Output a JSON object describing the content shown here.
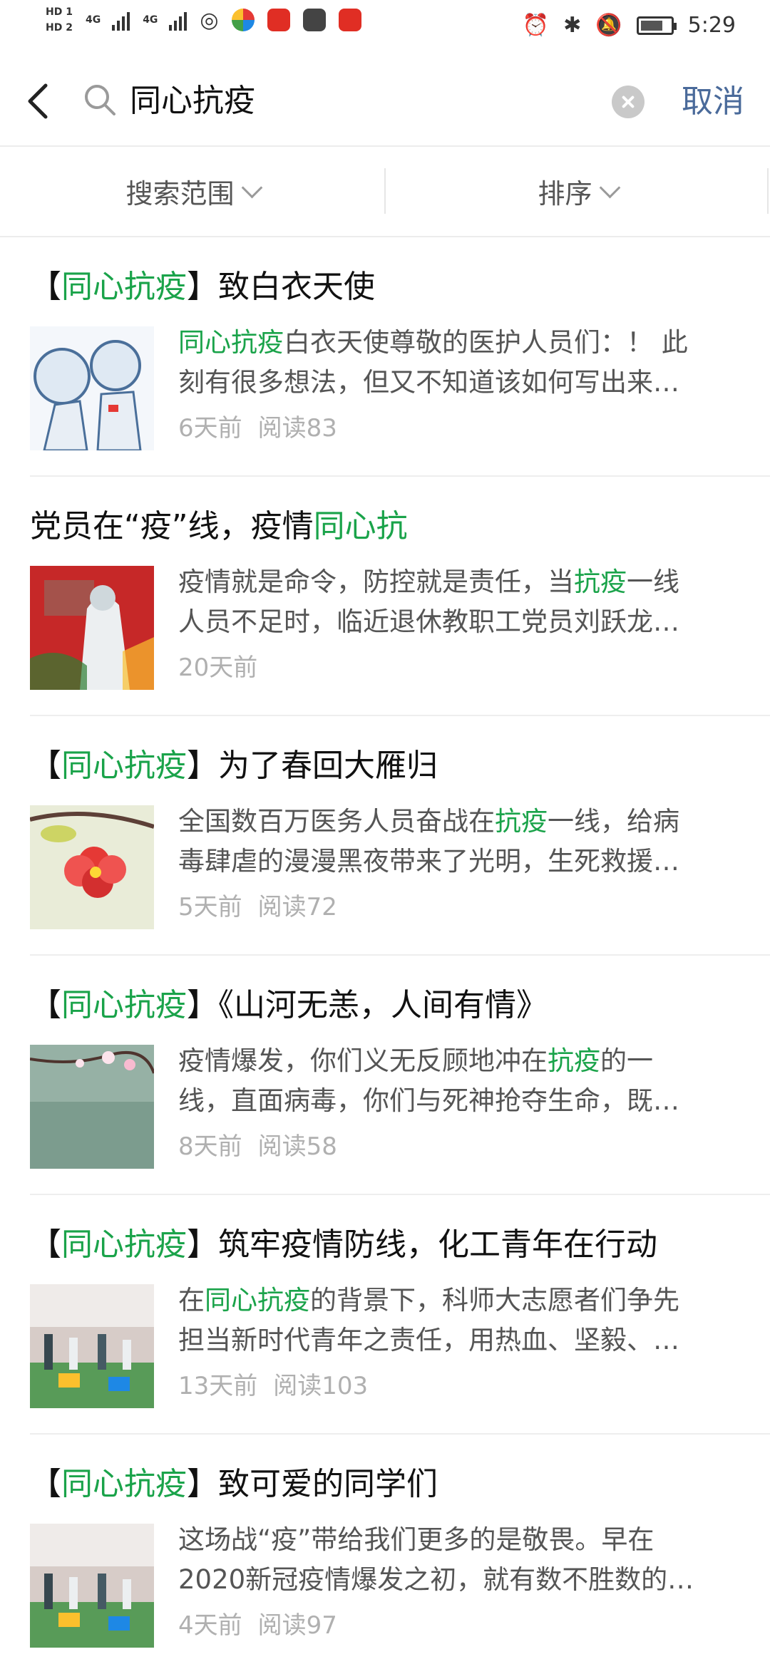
{
  "status_bar": {
    "hd1": "HD 1",
    "hd2": "HD 2",
    "sig1": "4G",
    "sig2": "4G",
    "time": "5:29"
  },
  "search": {
    "query": "同心抗疫",
    "cancel_label": "取消"
  },
  "filters": [
    {
      "label": "搜索范围"
    },
    {
      "label": "排序"
    }
  ],
  "colors": {
    "highlight": "#1aa34a",
    "cancel": "#4a6a9a",
    "meta": "#b0b0b0"
  },
  "results": [
    {
      "title": {
        "pre": "【",
        "hl": "同心抗疫",
        "post": "】致白衣天使"
      },
      "summary": {
        "l1_pre": "",
        "l1_hl": "同心抗疫",
        "l1_post": "白衣天使尊敬的医护人员们：！ 此",
        "l2": "刻有很多想法，但又不知道该如何写出来…"
      },
      "time": "6天前",
      "reads": "阅读83",
      "thumb_icon": "thumbnail-medic-cartoon"
    },
    {
      "title": {
        "pre": "党员在“疫”线，疫情",
        "hl": "同心抗",
        "post": ""
      },
      "summary": {
        "l1_pre": "疫情就是命令，防控就是责任，当",
        "l1_hl": "抗疫",
        "l1_post": "一线",
        "l2": "人员不足时，临近退休教职工党员刘跃龙…"
      },
      "time": "20天前",
      "reads": "",
      "thumb_icon": "thumbnail-red-poster"
    },
    {
      "title": {
        "pre": "【",
        "hl": "同心抗疫",
        "post": "】为了春回大雁归"
      },
      "summary": {
        "l1_pre": "全国数百万医务人员奋战在",
        "l1_hl": "抗疫",
        "l1_post": "一线，给病",
        "l2": "毒肆虐的漫漫黑夜带来了光明，生死救援…"
      },
      "time": "5天前",
      "reads": "阅读72",
      "thumb_icon": "thumbnail-red-flower"
    },
    {
      "title": {
        "pre": "【",
        "hl": "同心抗疫",
        "post": "】《山河无恙，人间有情》"
      },
      "summary": {
        "l1_pre": "疫情爆发，你们义无反顾地冲在",
        "l1_hl": "抗疫",
        "l1_post": "的一",
        "l2": "线，直面病毒，你们与死神抢夺生命，既…"
      },
      "time": "8天前",
      "reads": "阅读58",
      "thumb_icon": "thumbnail-blossom-branch"
    },
    {
      "title": {
        "pre": "【",
        "hl": "同心抗疫",
        "post": "】筑牢疫情防线，化工青年在行动"
      },
      "summary": {
        "l1_pre": "在",
        "l1_hl": "同心抗疫",
        "l1_post": "的背景下，科师大志愿者们争先",
        "l2": "担当新时代青年之责任，用热血、坚毅、…"
      },
      "time": "13天前",
      "reads": "阅读103",
      "thumb_icon": "thumbnail-gym-volunteers"
    },
    {
      "title": {
        "pre": "【",
        "hl": "同心抗疫",
        "post": "】致可爱的同学们"
      },
      "summary": {
        "l1_pre": "这场战“疫”带给我们更多的是敬畏。早在",
        "l1_hl": "",
        "l1_post": "",
        "l2": "2020新冠疫情爆发之初，就有数不胜数的…"
      },
      "time": "4天前",
      "reads": "阅读97",
      "thumb_icon": "thumbnail-gym-volunteers"
    }
  ]
}
